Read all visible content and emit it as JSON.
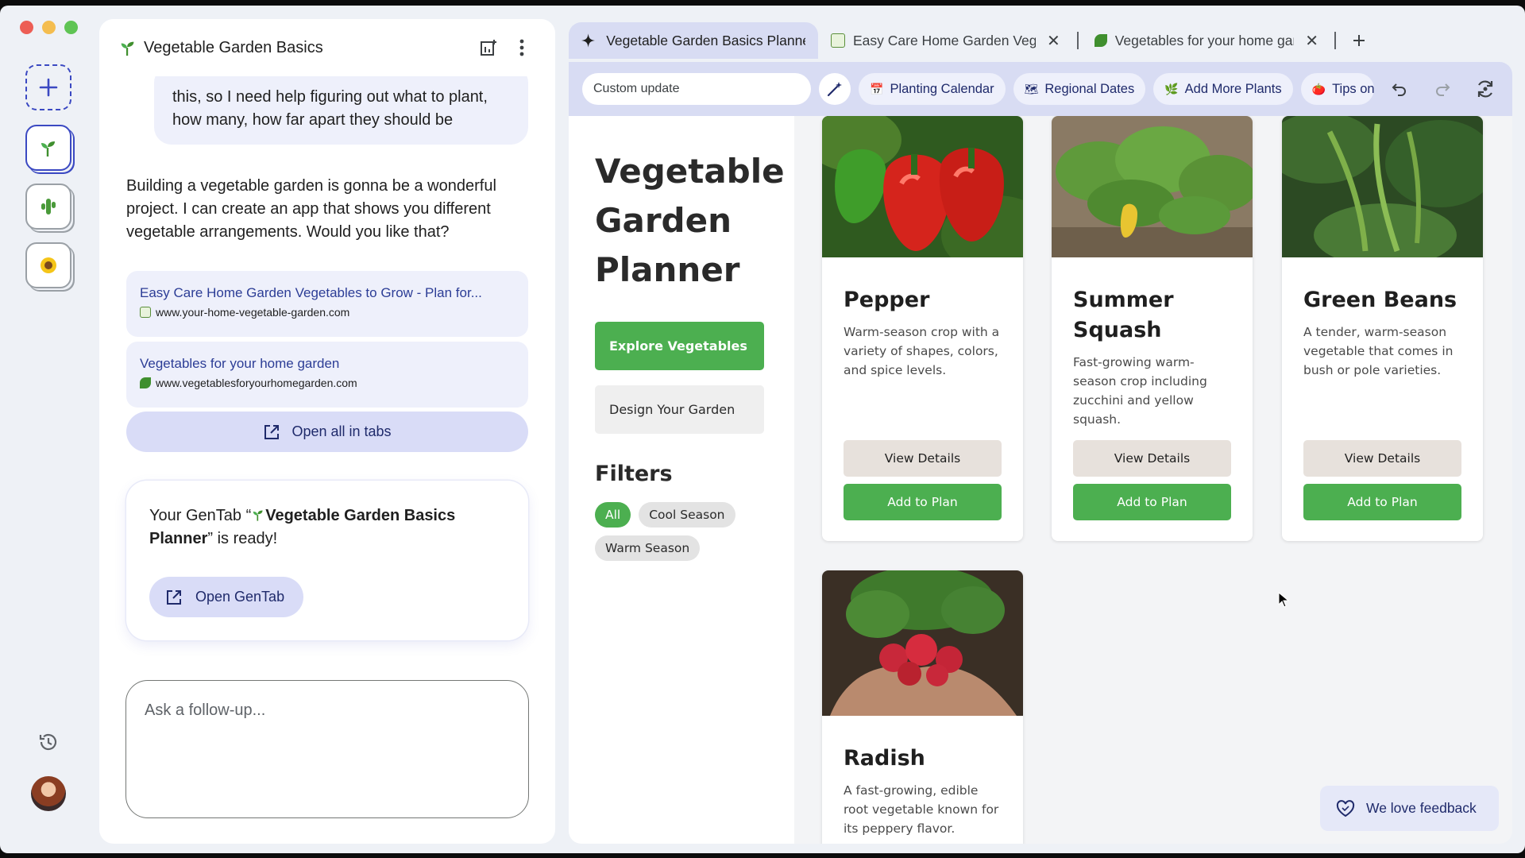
{
  "rail": {
    "new_icon": "plus-icon",
    "projects": [
      {
        "icon": "sprout-icon",
        "active": true
      },
      {
        "icon": "cactus-icon",
        "active": false
      },
      {
        "icon": "sunflower-icon",
        "active": false
      }
    ],
    "history_icon": "history-icon"
  },
  "chat": {
    "title": "Vegetable Garden Basics",
    "user_message": "this, so I need help figuring out what to plant, how many, how far apart they should be",
    "assistant_message": "Building a vegetable garden is gonna be a wonderful project. I can create an app that shows you different vegetable arrangements. Would you like that?",
    "sources": [
      {
        "title": "Easy Care Home Garden Vegetables to Grow - Plan for...",
        "url": "www.your-home-vegetable-garden.com"
      },
      {
        "title": "Vegetables for your home garden",
        "url": "www.vegetablesforyourhomegarden.com"
      }
    ],
    "open_all_label": "Open all in tabs",
    "ready_prefix": "Your GenTab “",
    "ready_name": "Vegetable Garden Basics Planner",
    "ready_suffix": "” is ready!",
    "open_gentab_label": "Open GenTab",
    "followup_placeholder": "Ask a follow-up..."
  },
  "tabs": [
    {
      "label": "Vegetable Garden Basics Planner",
      "active": true
    },
    {
      "label": "Easy Care Home Garden Vegetables",
      "active": false
    },
    {
      "label": "Vegetables for your home garden",
      "active": false
    }
  ],
  "toolbar": {
    "input_placeholder": "Custom update",
    "chips": [
      {
        "label": "Planting Calendar",
        "icon": "calendar-icon"
      },
      {
        "label": "Regional Dates",
        "icon": "map-icon"
      },
      {
        "label": "Add More Plants",
        "icon": "leaf-icon"
      },
      {
        "label": "Tips on",
        "icon": "tomato-icon"
      }
    ]
  },
  "planner": {
    "title": "Vegetable Garden Planner",
    "explore_label": "Explore Vegetables",
    "design_label": "Design Your Garden",
    "filters_title": "Filters",
    "filters": [
      "All",
      "Cool Season",
      "Warm Season"
    ],
    "active_filter": "All",
    "view_label": "View Details",
    "add_label": "Add to Plan",
    "cards": [
      {
        "name": "Pepper",
        "desc": "Warm-season crop with a variety of shapes, colors, and spice levels."
      },
      {
        "name": "Summer Squash",
        "desc": "Fast-growing warm-season crop including zucchini and yellow squash."
      },
      {
        "name": "Green Beans",
        "desc": "A tender, warm-season vegetable that comes in bush or pole varieties."
      },
      {
        "name": "Radish",
        "desc": "A fast-growing, edible root vegetable known for its peppery flavor."
      }
    ]
  },
  "feedback_label": "We love feedback",
  "colors": {
    "accent": "#4caf50",
    "brand": "#3b49c2",
    "chip_bg": "#eef0fb",
    "toolbar_bg": "#d8dcf3"
  }
}
